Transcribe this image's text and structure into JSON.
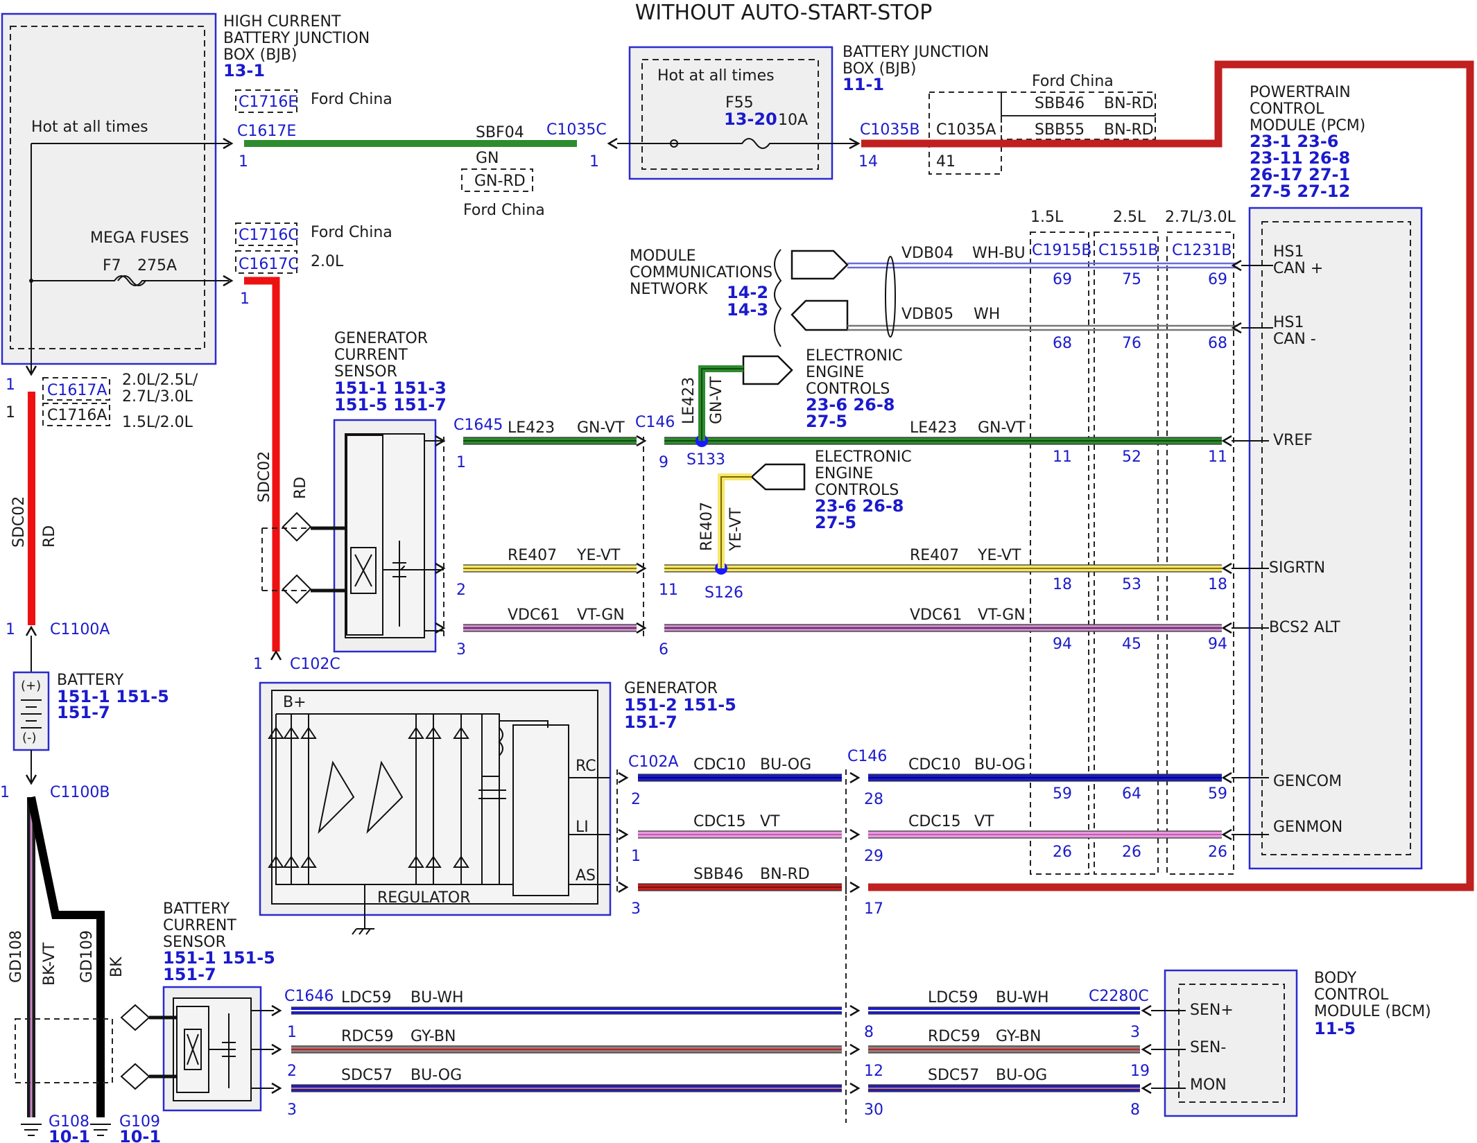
{
  "title": "WITHOUT AUTO-START-STOP",
  "colors": {
    "red": "#ee1111",
    "darkred": "#c02020",
    "green": "#2e8b2e",
    "yellow": "#f7e66b",
    "violet": "#c98bc9",
    "blue": "#1c1cc8",
    "pink": "#e99ae0",
    "grey": "#8f7e7e",
    "bkvt": "#1a1a1a",
    "connector": "#1a1acc"
  },
  "hcbjb": {
    "title": [
      "HIGH CURRENT",
      "BATTERY JUNCTION",
      "BOX (BJB)"
    ],
    "ref": "13-1",
    "hot": "Hot at all times",
    "mega": "MEGA FUSES",
    "fuse": "F7",
    "amp": "275A"
  },
  "bjb": {
    "title": [
      "BATTERY JUNCTION",
      "BOX (BJB)"
    ],
    "ref": "11-1",
    "hot": "Hot at all times",
    "fuse": "F55",
    "fuse_ref": "13-20",
    "amp": "10A"
  },
  "pcm": {
    "title": [
      "POWERTRAIN",
      "CONTROL",
      "MODULE (PCM)"
    ],
    "refs": [
      "23-1  23-6",
      "23-11 26-8",
      "26-17 27-1",
      "27-5  27-12"
    ],
    "pins": [
      "HS1",
      "CAN +",
      "HS1",
      "CAN -",
      "VREF",
      "SIGRTN",
      "BCS2 ALT",
      "GENCOM",
      "GENMON"
    ]
  },
  "bcm": {
    "title": [
      "BODY",
      "CONTROL",
      "MODULE (BCM)"
    ],
    "ref": "11-5",
    "pins": [
      "SEN+",
      "SEN-",
      "MON"
    ]
  },
  "generator": {
    "title": "GENERATOR",
    "refs": [
      "151-2 151-5",
      "151-7"
    ],
    "regulator": "REGULATOR",
    "bplus": "B+",
    "outs": [
      "RC",
      "LI",
      "AS"
    ]
  },
  "gen_sensor": {
    "title": [
      "GENERATOR",
      "CURRENT",
      "SENSOR"
    ],
    "refs": [
      "151-1 151-3",
      "151-5 151-7"
    ]
  },
  "bat_sensor": {
    "title": [
      "BATTERY",
      "CURRENT",
      "SENSOR"
    ],
    "refs": [
      "151-1 151-5",
      "151-7"
    ]
  },
  "battery": {
    "title": "BATTERY",
    "refs": [
      "151-1 151-5",
      "151-7"
    ],
    "plus": "(+)",
    "minus": "(-)"
  },
  "mcn": {
    "title": [
      "MODULE",
      "COMMUNICATIONS",
      "NETWORK"
    ],
    "refs": [
      "14-2",
      "14-3"
    ]
  },
  "eec1": {
    "title": [
      "ELECTRONIC",
      "ENGINE",
      "CONTROLS"
    ],
    "refs": [
      "23-6 26-8",
      "27-5"
    ]
  },
  "eec2": {
    "title": [
      "ELECTRONIC",
      "ENGINE",
      "CONTROLS"
    ],
    "refs": [
      "23-6 26-8",
      "27-5"
    ]
  },
  "columns": [
    "1.5L",
    "2.5L",
    "2.7L/3.0L"
  ],
  "labels": {
    "ford_china": "Ford China",
    "c1716e": "C1716E",
    "c1617e": "C1617E",
    "c1716c": "C1716C",
    "c1617c": "C1617C",
    "l20": "2.0L",
    "c1617a": "C1617A",
    "c1716a": "C1716A",
    "eng_a": "2.0L/2.5L/",
    "eng_b": "2.7L/3.0L",
    "eng_c": "1.5L/2.0L",
    "c1035c": "C1035C",
    "c1035b": "C1035B",
    "c1035a": "C1035A",
    "pin41": "41",
    "pin14": "14",
    "sbf04": "SBF04",
    "gn": "GN",
    "gnrd": "GN-RD",
    "sbb46": "SBB46",
    "sbb55": "SBB55",
    "bnrd": "BN-RD",
    "sdc02": "SDC02",
    "rd": "RD",
    "c1100a": "C1100A",
    "c1100b": "C1100B",
    "c102c": "C102C",
    "gd108": "GD108",
    "gd109": "GD109",
    "bkvt": "BK-VT",
    "bk": "BK",
    "g108": "G108",
    "g109": "G109",
    "gref": "10-1",
    "c1645": "C1645",
    "c146": "C146",
    "c102a": "C102A",
    "c1646": "C1646",
    "c2280c": "C2280C",
    "le423": "LE423",
    "gnvt": "GN-VT",
    "re407": "RE407",
    "yevt": "YE-VT",
    "vdc61": "VDC61",
    "vtgn": "VT-GN",
    "cdc10": "CDC10",
    "buog": "BU-OG",
    "cdc15": "CDC15",
    "vt": "VT",
    "bnrd2": "BN-RD",
    "ldc59": "LDC59",
    "buwh": "BU-WH",
    "rdc59": "RDC59",
    "gybn": "GY-BN",
    "sdc57": "SDC57",
    "vdb04": "VDB04",
    "whbu": "WH-BU",
    "vdb05": "VDB05",
    "wh": "WH",
    "c1915b": "C1915B",
    "c1551b": "C1551B",
    "c1231b": "C1231B",
    "s133": "S133",
    "s126": "S126"
  },
  "pin_numbers": {
    "col1": [
      "69",
      "68",
      "11",
      "18",
      "94",
      "59",
      "26"
    ],
    "col2": [
      "75",
      "76",
      "52",
      "53",
      "45",
      "64",
      "26"
    ],
    "col3": [
      "69",
      "68",
      "11",
      "18",
      "94",
      "59",
      "26"
    ],
    "left": [
      "1",
      "2",
      "3"
    ],
    "c146": [
      "9",
      "11",
      "6"
    ],
    "c102a": [
      "2",
      "1",
      "3"
    ],
    "c146b": [
      "28",
      "29",
      "17"
    ],
    "c1646": [
      "1",
      "2",
      "3"
    ],
    "mid": [
      "8",
      "12",
      "30"
    ],
    "c2280c": [
      "3",
      "19",
      "8"
    ],
    "misc": [
      "1",
      "1",
      "1",
      "1",
      "1",
      "1",
      "1",
      "1",
      "1"
    ]
  }
}
